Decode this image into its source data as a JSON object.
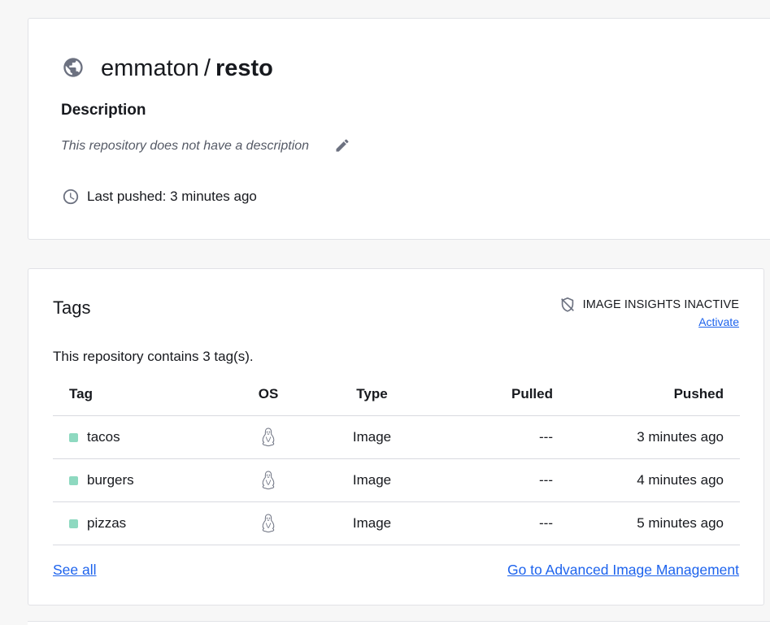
{
  "repository": {
    "namespace": "emmaton",
    "separator": "/",
    "name": "resto",
    "description_heading": "Description",
    "description_text": "This repository does not have a description",
    "last_pushed": "Last pushed: 3 minutes ago"
  },
  "tags_section": {
    "heading": "Tags",
    "insights_status": "IMAGE INSIGHTS INACTIVE",
    "activate_label": "Activate",
    "count_text": "This repository contains 3 tag(s).",
    "columns": [
      "Tag",
      "OS",
      "Type",
      "Pulled",
      "Pushed"
    ],
    "rows": [
      {
        "tag": "tacos",
        "os_icon": "linux-icon",
        "type": "Image",
        "pulled": "---",
        "pushed": "3 minutes ago"
      },
      {
        "tag": "burgers",
        "os_icon": "linux-icon",
        "type": "Image",
        "pulled": "---",
        "pushed": "4 minutes ago"
      },
      {
        "tag": "pizzas",
        "os_icon": "linux-icon",
        "type": "Image",
        "pulled": "---",
        "pushed": "5 minutes ago"
      }
    ],
    "see_all_label": "See all",
    "advanced_label": "Go to Advanced Image Management"
  },
  "colors": {
    "link": "#1d63ed",
    "tag_dot": "#8ed9c0",
    "icon_gray": "#6c7180"
  },
  "icons": {
    "repo": "globe-icon",
    "edit": "pencil-icon",
    "last_pushed": "clock-icon",
    "insights": "shield-off-icon"
  }
}
